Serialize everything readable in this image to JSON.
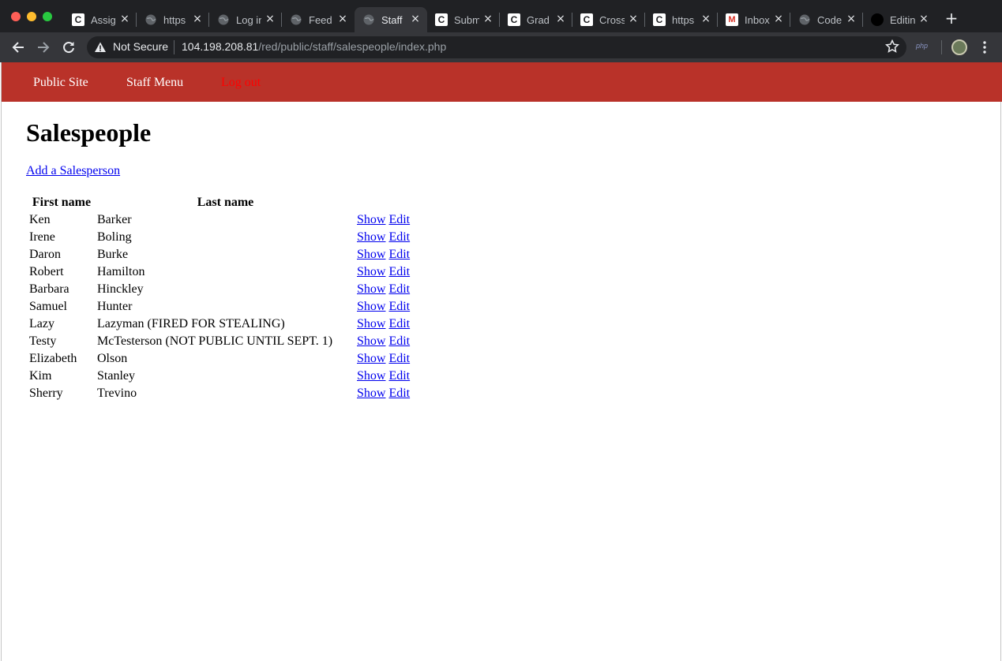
{
  "browser": {
    "tabs": [
      {
        "title": "Assig",
        "favicon": "c-icon"
      },
      {
        "title": "https",
        "favicon": "globe-icon"
      },
      {
        "title": "Log in",
        "favicon": "globe-icon"
      },
      {
        "title": "Feed",
        "favicon": "globe-icon"
      },
      {
        "title": "Staff",
        "favicon": "globe-icon",
        "active": true
      },
      {
        "title": "Subm",
        "favicon": "c-icon"
      },
      {
        "title": "Grad",
        "favicon": "c-icon"
      },
      {
        "title": "Cross",
        "favicon": "c-icon"
      },
      {
        "title": "https",
        "favicon": "c-icon"
      },
      {
        "title": "Inbox",
        "favicon": "gmail-icon"
      },
      {
        "title": "Code",
        "favicon": "globe-icon"
      },
      {
        "title": "Editin",
        "favicon": "github-icon"
      }
    ],
    "security_label": "Not Secure",
    "url_host": "104.198.208.81",
    "url_path": "/red/public/staff/salespeople/index.php",
    "extension_label": "php"
  },
  "nav": {
    "public_site": "Public Site",
    "staff_menu": "Staff Menu",
    "logout": "Log out"
  },
  "main": {
    "title": "Salespeople",
    "add_link": "Add a Salesperson",
    "columns": [
      "First name",
      "Last name"
    ],
    "action_show": "Show",
    "action_edit": "Edit",
    "rows": [
      [
        "Ken",
        "Barker"
      ],
      [
        "Irene",
        "Boling"
      ],
      [
        "Daron",
        "Burke"
      ],
      [
        "Robert",
        "Hamilton"
      ],
      [
        "Barbara",
        "Hinckley"
      ],
      [
        "Samuel",
        "Hunter"
      ],
      [
        "Lazy",
        "Lazyman (FIRED FOR STEALING)"
      ],
      [
        "Testy",
        "McTesterson (NOT PUBLIC UNTIL SEPT. 1)"
      ],
      [
        "Elizabeth",
        "Olson"
      ],
      [
        "Kim",
        "Stanley"
      ],
      [
        "Sherry",
        "Trevino"
      ]
    ]
  },
  "colors": {
    "nav_background": "#b93229",
    "logout_link": "#ff0000",
    "link": "#0000ee"
  }
}
